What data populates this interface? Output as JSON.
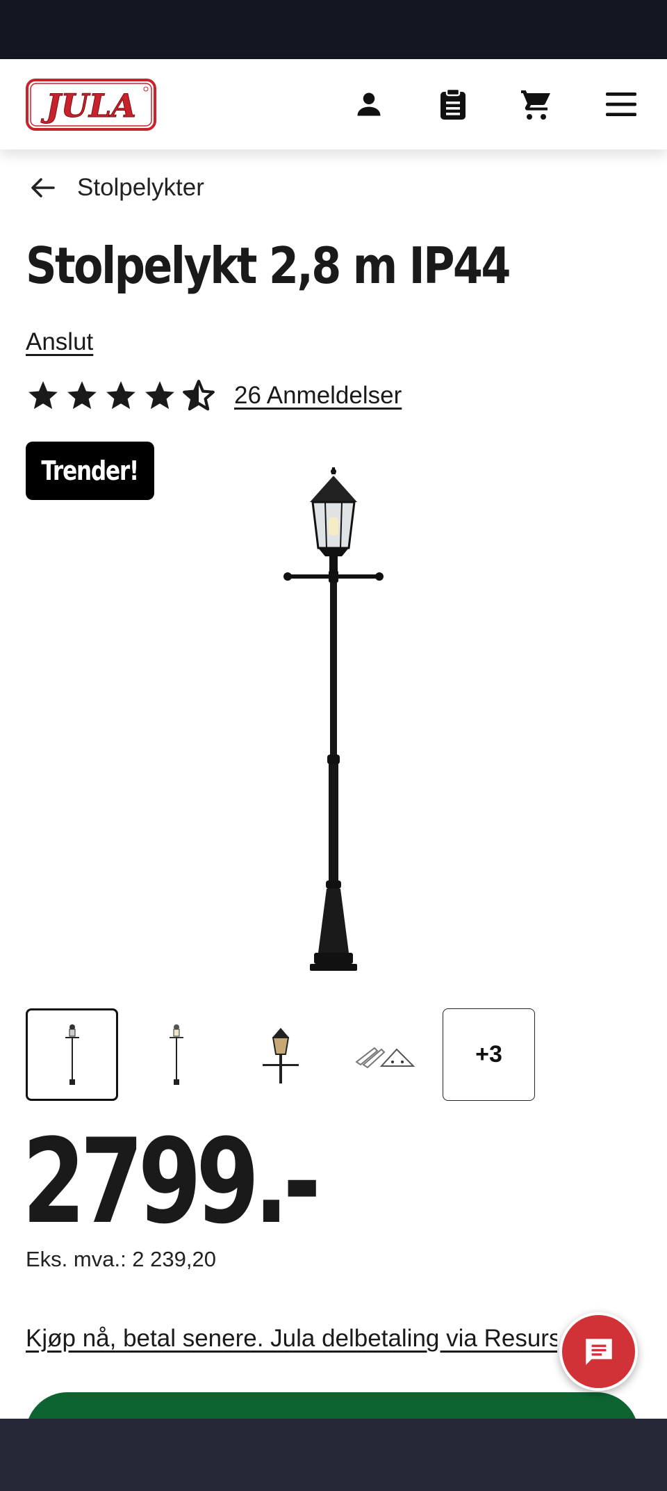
{
  "header": {
    "logo_text": "JULA",
    "icons": [
      "account-icon",
      "shopping-list-icon",
      "cart-icon",
      "menu-icon"
    ]
  },
  "breadcrumb": {
    "label": "Stolpelykter"
  },
  "product": {
    "title": "Stolpelykt 2,8 m IP44",
    "brand": "Anslut",
    "rating": 4.5,
    "reviews_label": "26 Anmeldelser",
    "badge": "Trender!",
    "thumbnails_more": "+3",
    "price": "2799.-",
    "ex_vat": "Eks. mva.: 2 239,20",
    "finance_link": "Kjøp nå, betal senere. Jula delbetaling via Resurs Bank"
  },
  "colors": {
    "status_bar": "#141722",
    "brand_red": "#d03238",
    "buy_green": "#0d6431",
    "badge_bg": "#000000"
  }
}
